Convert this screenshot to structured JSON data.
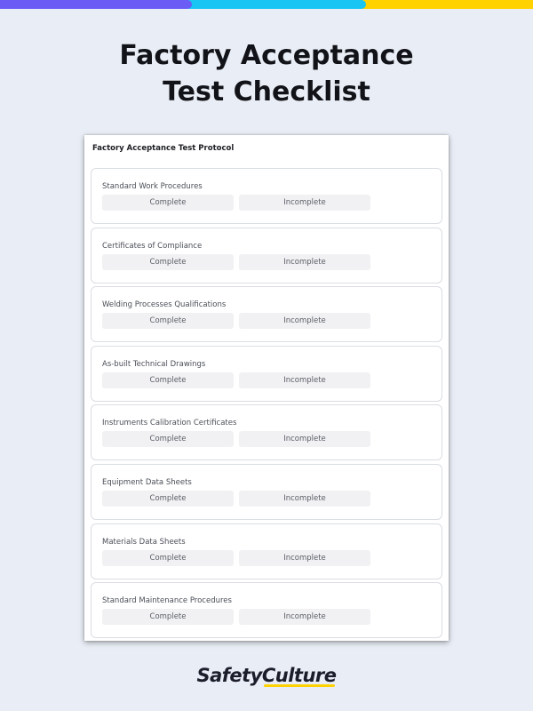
{
  "colors": {
    "background": "#e9edf5",
    "bar_purple": "#6b5cf6",
    "bar_cyan": "#18c5f3",
    "bar_yellow": "#ffd200",
    "brand_underline": "#ffd200"
  },
  "headline": {
    "line1": "Factory Acceptance",
    "line2": "Test Checklist"
  },
  "sheet": {
    "title": "Factory Acceptance Test Protocol",
    "items": [
      {
        "label": "Standard Work Procedures",
        "option_a": "Complete",
        "option_b": "Incomplete"
      },
      {
        "label": "Certificates of Compliance",
        "option_a": "Complete",
        "option_b": "Incomplete"
      },
      {
        "label": "Welding Processes Qualifications",
        "option_a": "Complete",
        "option_b": "Incomplete"
      },
      {
        "label": "As-built Technical Drawings",
        "option_a": "Complete",
        "option_b": "Incomplete"
      },
      {
        "label": "Instruments Calibration Certificates",
        "option_a": "Complete",
        "option_b": "Incomplete"
      },
      {
        "label": "Equipment Data Sheets",
        "option_a": "Complete",
        "option_b": "Incomplete"
      },
      {
        "label": "Materials Data Sheets",
        "option_a": "Complete",
        "option_b": "Incomplete"
      },
      {
        "label": "Standard Maintenance Procedures",
        "option_a": "Complete",
        "option_b": "Incomplete"
      }
    ]
  },
  "brand": {
    "part1": "Safety",
    "part2": "Culture"
  }
}
